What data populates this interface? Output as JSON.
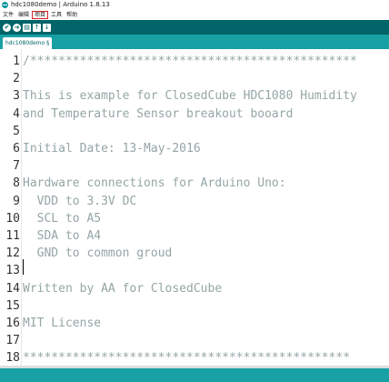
{
  "window": {
    "title": "hdc1080demo | Arduino 1.8.13"
  },
  "menu": {
    "items": [
      "文件",
      "编辑",
      "项目",
      "工具",
      "帮助"
    ],
    "active_index": 2
  },
  "toolbar": {
    "verify_icon": "✔",
    "upload_icon": "➜",
    "new_icon": "▤",
    "open_icon": "↑",
    "save_icon": "↓"
  },
  "tabs": [
    {
      "label": "hdc1080demo §"
    }
  ],
  "editor": {
    "lines": [
      {
        "num": "1",
        "text": "/**********************************************"
      },
      {
        "num": "2",
        "text": ""
      },
      {
        "num": "3",
        "text": "This is example for ClosedCube HDC1080 Humidity"
      },
      {
        "num": "4",
        "text": "and Temperature Sensor breakout booard"
      },
      {
        "num": "5",
        "text": ""
      },
      {
        "num": "6",
        "text": "Initial Date: 13-May-2016"
      },
      {
        "num": "7",
        "text": ""
      },
      {
        "num": "8",
        "text": "Hardware connections for Arduino Uno:"
      },
      {
        "num": "9",
        "text": "  VDD to 3.3V DC"
      },
      {
        "num": "10",
        "text": "  SCL to A5"
      },
      {
        "num": "11",
        "text": "  SDA to A4"
      },
      {
        "num": "12",
        "text": "  GND to common groud"
      },
      {
        "num": "13",
        "text": ""
      },
      {
        "num": "14",
        "text": "Written by AA for ClosedCube"
      },
      {
        "num": "15",
        "text": ""
      },
      {
        "num": "16",
        "text": "MIT License"
      },
      {
        "num": "17",
        "text": ""
      },
      {
        "num": "18",
        "text": "**********************************************"
      }
    ]
  }
}
